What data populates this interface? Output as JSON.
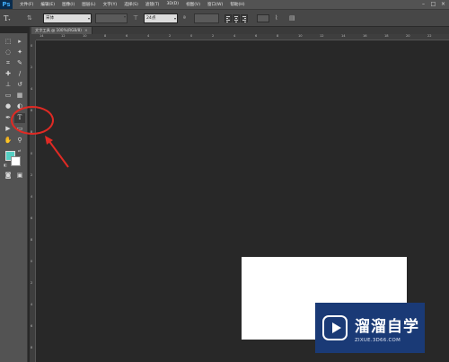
{
  "app": {
    "logo": "Ps",
    "menu": [
      "文件(F)",
      "编辑(E)",
      "图像(I)",
      "图层(L)",
      "文字(Y)",
      "选择(S)",
      "滤镜(T)",
      "3D(D)",
      "视图(V)",
      "窗口(W)",
      "帮助(H)"
    ],
    "window_controls": [
      "minimize-icon",
      "restore-icon",
      "close-icon"
    ]
  },
  "options": {
    "tool_glyph": "T",
    "tool_arrow": "▾",
    "font_family": "宋体",
    "font_size": "24点",
    "colors": {
      "text_color": "#5a5a5a"
    }
  },
  "document": {
    "tab_title": "文字工具 @ 100%(RGB/8)",
    "tab_close": "×",
    "canvas_color": "#ffffff"
  },
  "rulers": {
    "top": [
      "14",
      "12",
      "10",
      "8",
      "6",
      "4",
      "2",
      "0",
      "2",
      "4",
      "6",
      "8",
      "10",
      "12",
      "14",
      "16",
      "18",
      "20",
      "22"
    ],
    "left": [
      "0",
      "2",
      "4",
      "6",
      "8",
      "0",
      "2",
      "4",
      "6",
      "8",
      "0",
      "2",
      "4",
      "6",
      "8",
      "0"
    ]
  },
  "toolbar": {
    "selected": "horizontal-type-tool",
    "type_tool_glyph": "T",
    "foreground_color": "#55cfc3",
    "background_color": "#ffffff"
  },
  "annotation": {
    "color": "#e02a24"
  },
  "watermark": {
    "title": "溜溜自学",
    "url": "ZIXUE.3D66.COM"
  }
}
